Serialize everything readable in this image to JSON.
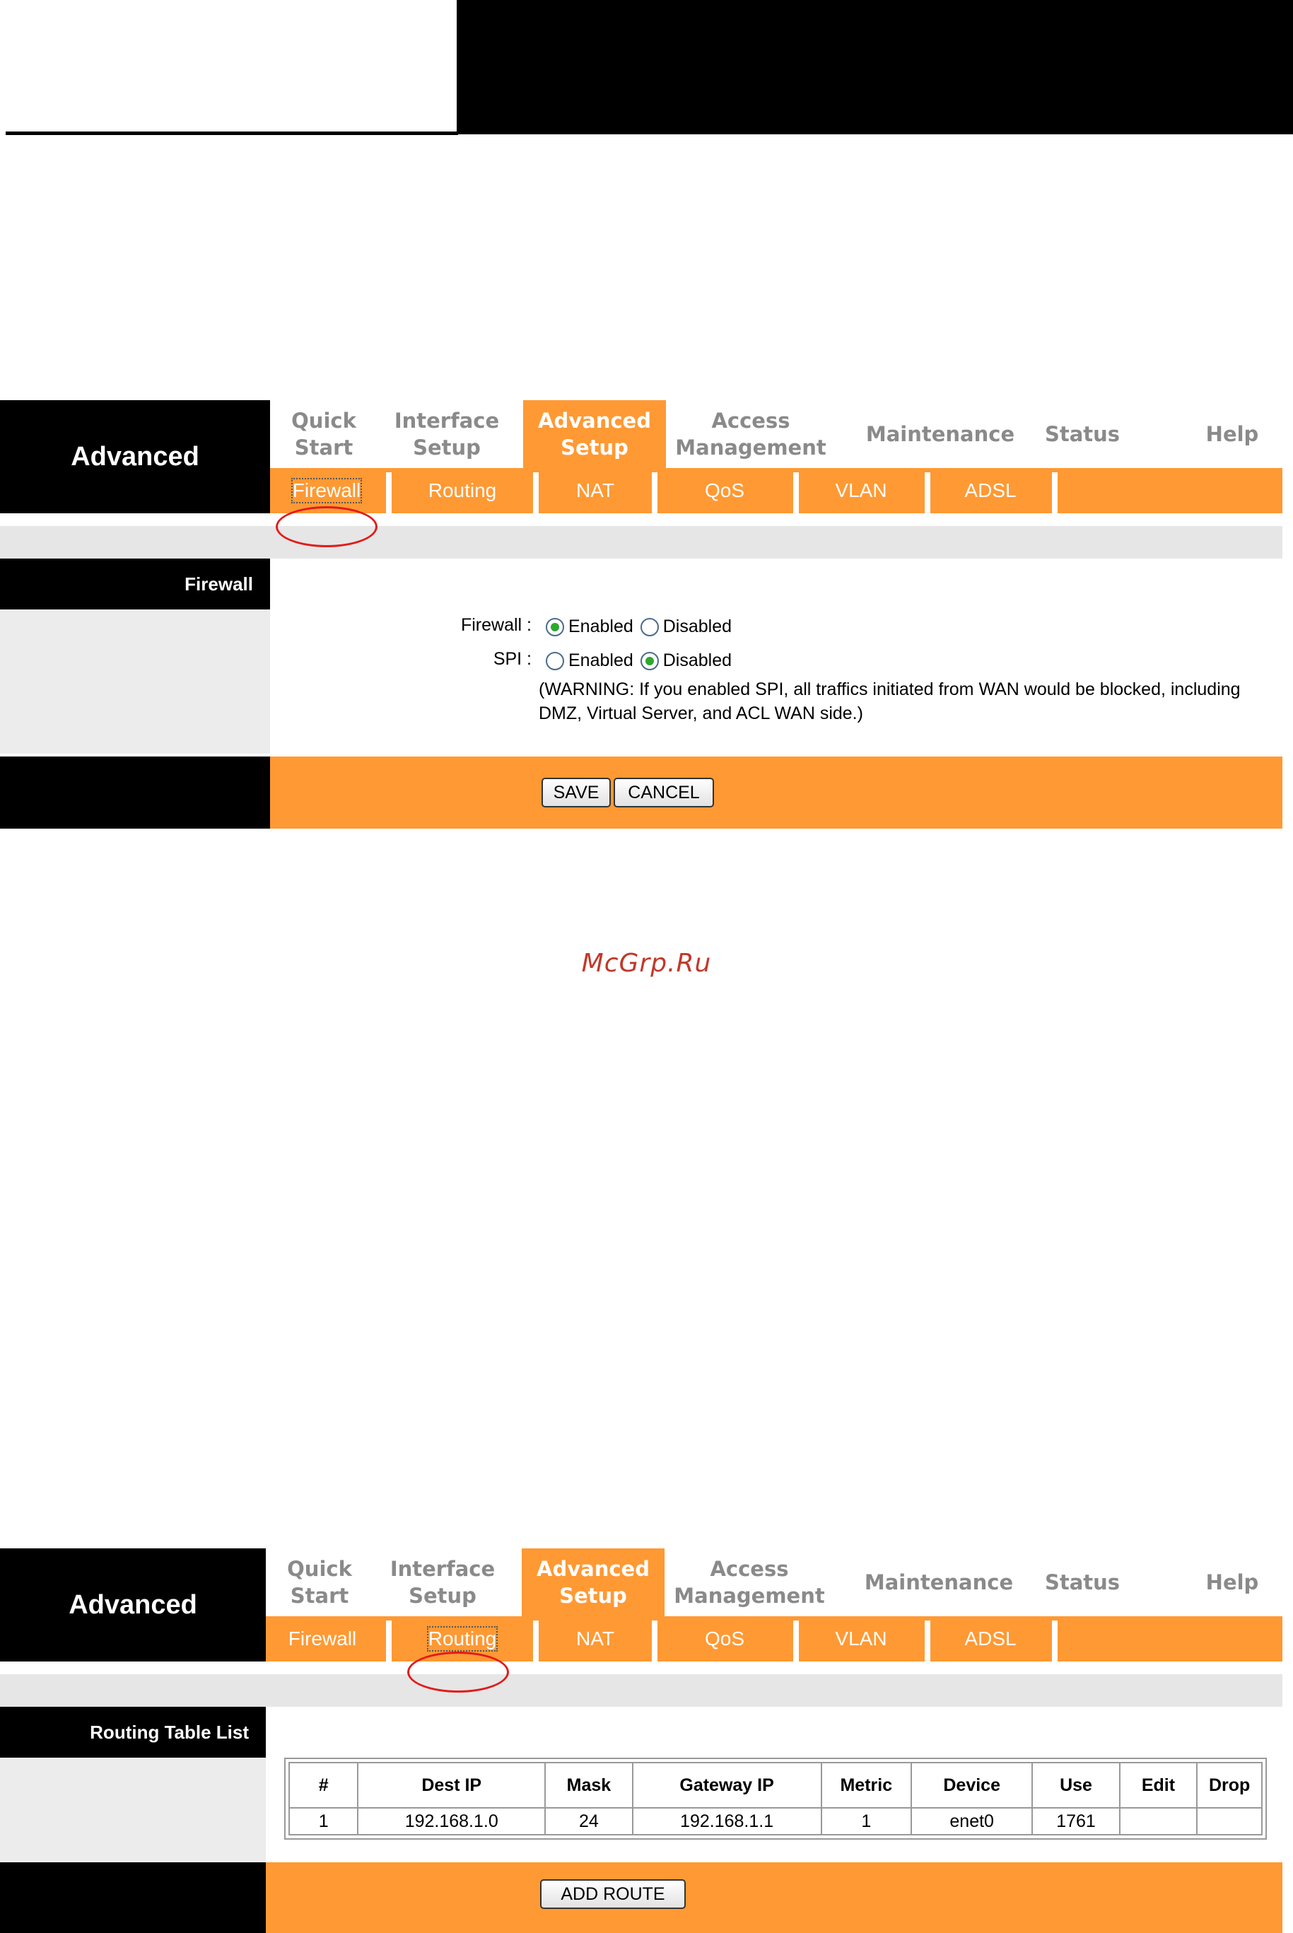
{
  "nav": {
    "brand": "Advanced",
    "tabs": [
      {
        "line1": "Quick",
        "line2": "Start"
      },
      {
        "line1": "Interface",
        "line2": "Setup"
      },
      {
        "line1": "Advanced",
        "line2": "Setup"
      },
      {
        "line1": "Access",
        "line2": "Management"
      },
      {
        "line1": "Maintenance",
        "line2": ""
      },
      {
        "line1": "Status",
        "line2": ""
      },
      {
        "line1": "Help",
        "line2": ""
      }
    ],
    "active_tab": "Advanced Setup",
    "subtabs": [
      "Firewall",
      "Routing",
      "NAT",
      "QoS",
      "VLAN",
      "ADSL"
    ]
  },
  "firewall_panel": {
    "active_subtab": "Firewall",
    "section_title": "Firewall",
    "firewall_label": "Firewall :",
    "spi_label": "SPI :",
    "enabled_label": "Enabled",
    "disabled_label": "Disabled",
    "firewall_value": "Enabled",
    "spi_value": "Disabled",
    "warning_line1": "(WARNING: If you enabled SPI, all traffics initiated from WAN would be blocked, including",
    "warning_line2": "DMZ, Virtual Server, and ACL WAN side.)",
    "save_button": "SAVE",
    "cancel_button": "CANCEL"
  },
  "routing_panel": {
    "active_subtab": "Routing",
    "section_title": "Routing Table List",
    "columns": [
      "#",
      "Dest IP",
      "Mask",
      "Gateway IP",
      "Metric",
      "Device",
      "Use",
      "Edit",
      "Drop"
    ],
    "rows": [
      [
        "1",
        "192.168.1.0",
        "24",
        "192.168.1.1",
        "1",
        "enet0",
        "1761",
        "",
        ""
      ]
    ],
    "add_route_button": "ADD ROUTE"
  },
  "watermark": "McGrp.Ru",
  "colors": {
    "accent": "#ff9933",
    "header": "#000000",
    "gray": "#e6e6e6",
    "annotation": "#e21b1b"
  }
}
